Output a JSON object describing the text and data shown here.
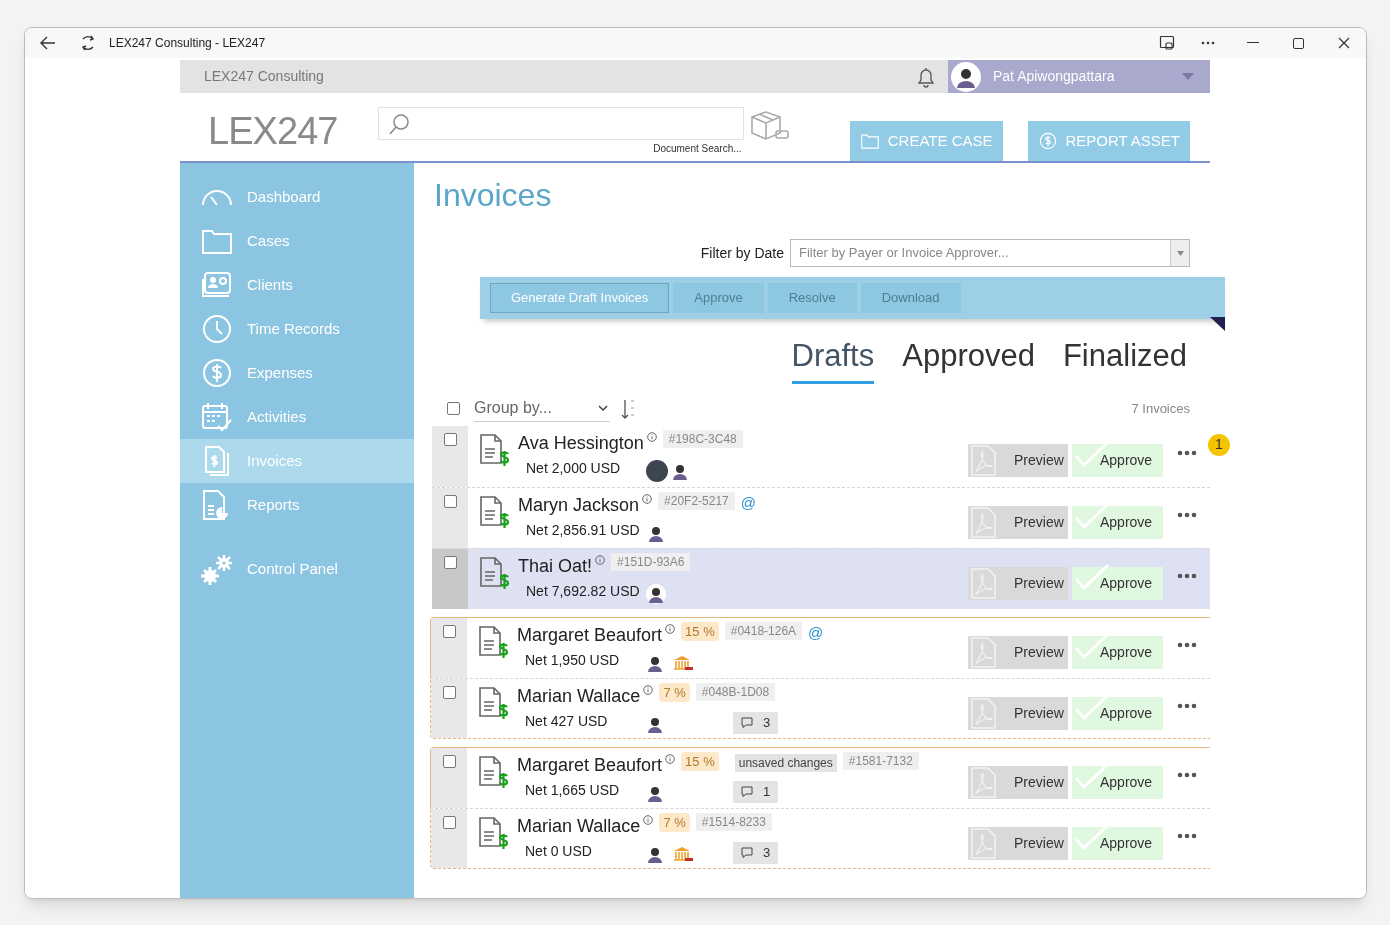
{
  "browser": {
    "title": "LEX247 Consulting - LEX247"
  },
  "topbar": {
    "org": "LEX247 Consulting",
    "user": "Pat Apiwongpattara"
  },
  "header": {
    "logo": "**LEX**247",
    "search_caption": "Document Search...",
    "buttons": [
      {
        "kind": "folder",
        "label": "CREATE CASE"
      },
      {
        "kind": "dollar",
        "label": "REPORT ASSET"
      }
    ]
  },
  "sidebar": {
    "items": [
      {
        "kind": "gauge",
        "label": "Dashboard",
        "selected": false
      },
      {
        "kind": "folder",
        "label": "Cases",
        "selected": false
      },
      {
        "kind": "contacts",
        "label": "Clients",
        "selected": false
      },
      {
        "kind": "clock",
        "label": "Time Records",
        "selected": false
      },
      {
        "kind": "dollar",
        "label": "Expenses",
        "selected": false
      },
      {
        "kind": "calendar",
        "label": "Activities",
        "selected": false
      },
      {
        "kind": "invoice",
        "label": "Invoices",
        "selected": true
      },
      {
        "kind": "report",
        "label": "Reports",
        "selected": false
      },
      {
        "kind": "gears",
        "label": "Control Panel",
        "selected": false
      }
    ]
  },
  "page": {
    "title": "Invoices",
    "filter_label": "Filter by Date",
    "filter_placeholder": "Filter by Payer or Invoice Approver..."
  },
  "toolbar": [
    {
      "label": "Generate Draft Invoices",
      "disabled": false
    },
    {
      "label": "Approve",
      "disabled": true
    },
    {
      "label": "Resolve",
      "disabled": true
    },
    {
      "label": "Download",
      "disabled": true
    }
  ],
  "tabs": [
    {
      "label": "Drafts",
      "selected": true
    },
    {
      "label": "Approved",
      "selected": false
    },
    {
      "label": "Finalized",
      "selected": false
    }
  ],
  "list": {
    "group_by": "Group by...",
    "count": "7 Invoices",
    "select_all": false,
    "groups": [
      {
        "bordered": false,
        "rows": [
          {
            "name": "Ava Hessington",
            "ref": "#198C-3C48",
            "net": "Net 2,000 USD",
            "avatars": [
              {
                "kind": "photo"
              },
              {
                "kind": "person"
              }
            ],
            "checked": false,
            "hovered": false,
            "badge": "1",
            "actions": [
              "Preview",
              "Approve"
            ]
          },
          {
            "name": "Maryn Jackson",
            "ref": "#20F2-5217",
            "mention": "@",
            "net": "Net 2,856.91 USD",
            "avatars": [
              {
                "kind": "person"
              }
            ],
            "checked": false,
            "hovered": false,
            "actions": [
              "Preview",
              "Approve"
            ]
          },
          {
            "name": "Thai Oat!",
            "ref": "#151D-93A6",
            "net": "Net 7,692.82 USD",
            "avatars": [
              {
                "kind": "person"
              }
            ],
            "checked": false,
            "hovered": true,
            "actions": [
              "Preview",
              "Approve"
            ]
          }
        ]
      },
      {
        "bordered": true,
        "rows": [
          {
            "name": "Margaret Beaufort",
            "tax": "15 %",
            "ref": "#0418-126A",
            "mention": "@",
            "net": "Net 1,950 USD",
            "avatars": [
              {
                "kind": "person"
              }
            ],
            "bank": true,
            "checked": false,
            "hovered": false,
            "actions": [
              "Preview",
              "Approve"
            ]
          },
          {
            "name": "Marian Wallace",
            "tax": "7 %",
            "ref": "#048B-1D08",
            "net": "Net 427 USD",
            "avatars": [
              {
                "kind": "person"
              }
            ],
            "comments": "3",
            "checked": false,
            "hovered": false,
            "actions": [
              "Preview",
              "Approve"
            ]
          }
        ]
      },
      {
        "bordered": true,
        "rows": [
          {
            "name": "Margaret Beaufort",
            "tax": "15 %",
            "tag": "unsaved changes",
            "ref": "#1581-7132",
            "net": "Net 1,665 USD",
            "avatars": [
              {
                "kind": "person"
              }
            ],
            "comments": "1",
            "checked": false,
            "hovered": false,
            "actions": [
              "Preview",
              "Approve"
            ]
          },
          {
            "name": "Marian Wallace",
            "tax": "7 %",
            "ref": "#1514-8233",
            "net": "Net 0 USD",
            "avatars": [
              {
                "kind": "person"
              }
            ],
            "bank": true,
            "comments": "3",
            "checked": false,
            "hovered": false,
            "actions": [
              "Preview",
              "Approve"
            ]
          }
        ]
      }
    ]
  }
}
